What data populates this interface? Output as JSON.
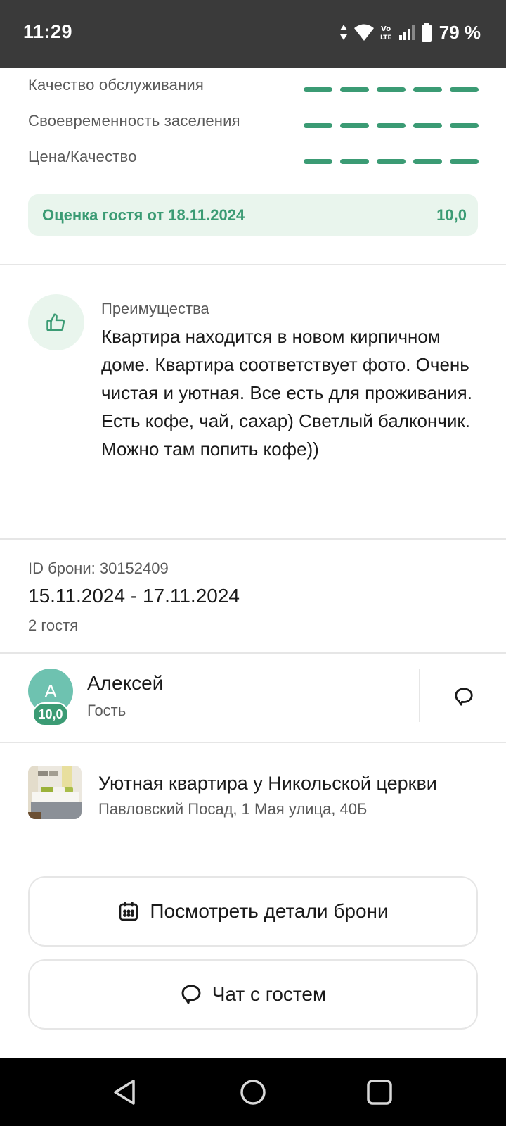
{
  "status_bar": {
    "time": "11:29",
    "network_label": "Vo LTE",
    "battery": "79 %"
  },
  "ratings": [
    {
      "label": "Качество обслуживания",
      "score_out_of_5": 5
    },
    {
      "label": "Своевременность заселения",
      "score_out_of_5": 5
    },
    {
      "label": "Цена/Качество",
      "score_out_of_5": 5
    }
  ],
  "guest_score": {
    "title": "Оценка гостя от 18.11.2024",
    "value": "10,0"
  },
  "advantages": {
    "title": "Преимущества",
    "text": "Квартира находится в новом кирпичном доме. Квартира соответствует фото. Очень чистая и уютная. Все есть для проживания. Есть кофе, чай, сахар) Светлый балкончик. Можно там попить кофе))"
  },
  "booking": {
    "id_label": "ID брони: 30152409",
    "dates": "15.11.2024 - 17.11.2024",
    "guests": "2 гостя"
  },
  "guest": {
    "initial": "А",
    "rating": "10,0",
    "name": "Алексей",
    "role": "Гость"
  },
  "property": {
    "title": "Уютная квартира у Никольской церкви",
    "address": "Павловский Посад, 1 Мая улица, 40Б"
  },
  "buttons": {
    "booking_details": "Посмотреть детали брони",
    "chat_with_guest": "Чат с гостем"
  },
  "colors": {
    "accent": "#3b9b74",
    "accent_light": "#e9f5ed",
    "avatar": "#6ec2b0"
  },
  "icons": {
    "advantages": "thumbs-up-icon",
    "chat": "chat-bubble-icon",
    "calendar": "calendar-icon"
  }
}
